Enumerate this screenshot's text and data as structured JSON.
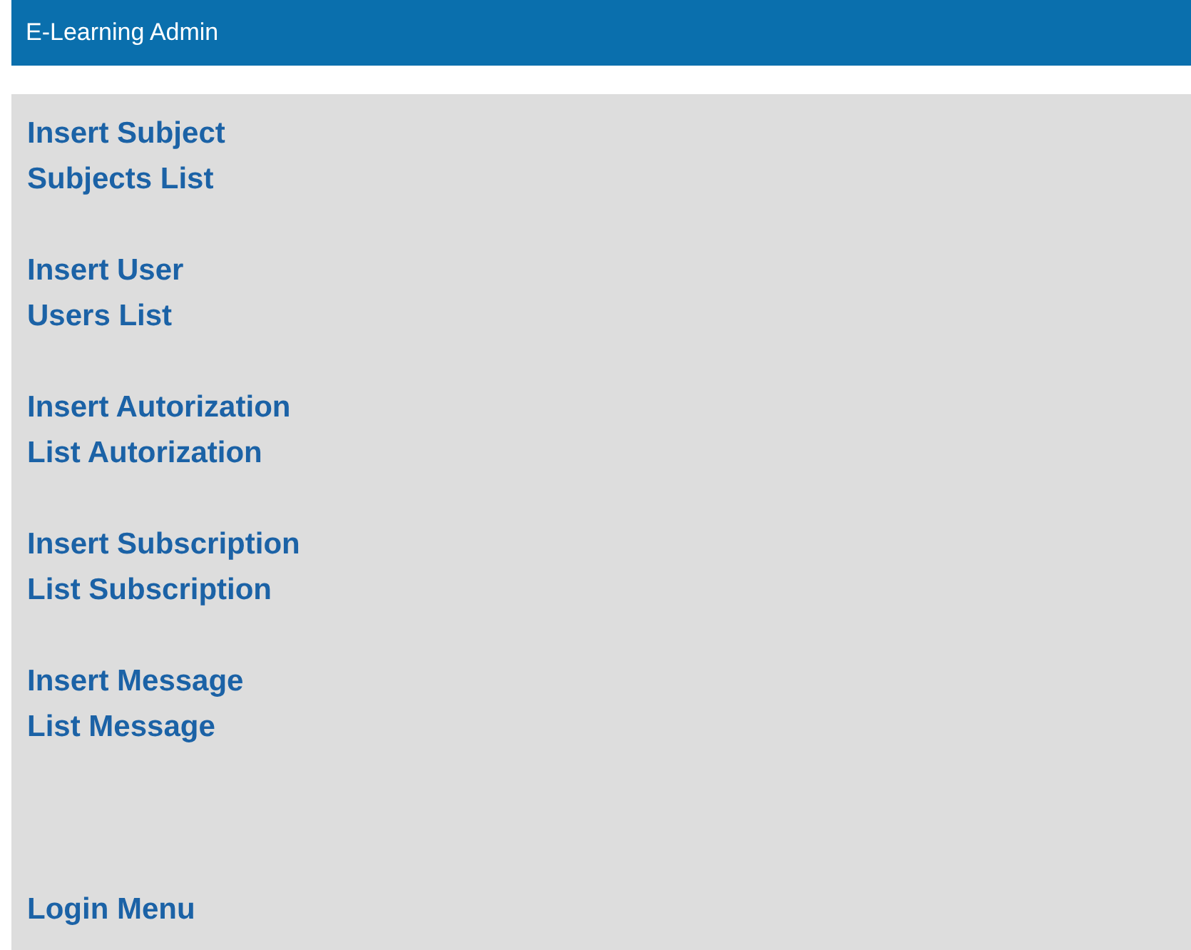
{
  "header": {
    "title": "E-Learning Admin"
  },
  "menu_groups": [
    {
      "links": [
        "Insert Subject",
        "Subjects List"
      ]
    },
    {
      "links": [
        "Insert User",
        "Users List"
      ]
    },
    {
      "links": [
        "Insert Autorization",
        "List Autorization"
      ]
    },
    {
      "links": [
        "Insert Subscription",
        "List Subscription"
      ]
    },
    {
      "links": [
        "Insert Message",
        "List Message"
      ]
    }
  ],
  "footer_link": "Login Menu"
}
